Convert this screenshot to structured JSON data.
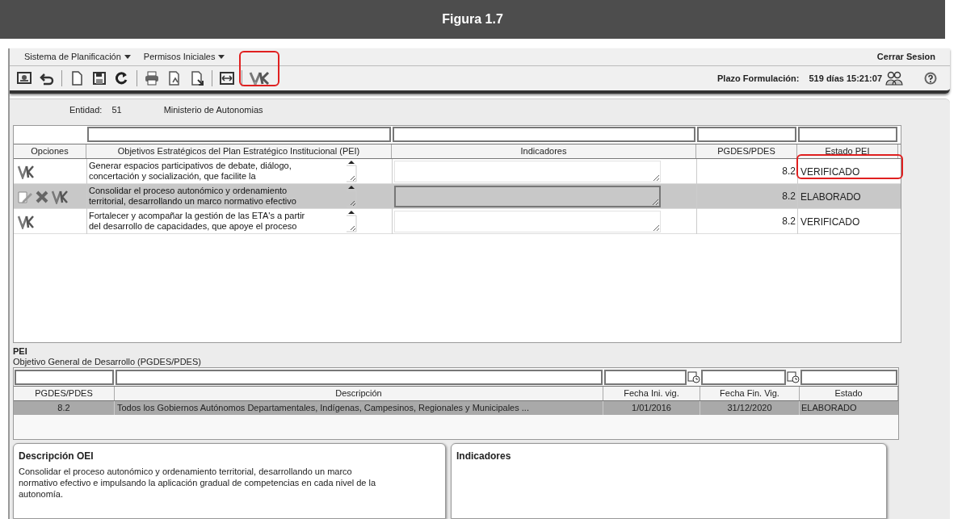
{
  "figure": {
    "title": "Figura 1.7"
  },
  "menu": [
    {
      "label": "Sistema de Planificación"
    },
    {
      "label": "Permisos Iniciales"
    }
  ],
  "logout": "Cerrar Sesion",
  "toolbar": {
    "verify_highlighted": true
  },
  "deadline": {
    "label": "Plazo Formulación:",
    "value": "519 días 15:21:07"
  },
  "entity": {
    "label": "Entidad:",
    "code": "51",
    "name": "Ministerio de Autonomias"
  },
  "objectives_table": {
    "columns": [
      "Opciones",
      "Objetivos Estratégicos del Plan Estratégico Institucional (PEI)",
      "Indicadores",
      "PGDES/PDES",
      "Estado PEI"
    ],
    "rows": [
      {
        "kind": "verify",
        "selected": false,
        "highlighted": true,
        "objective": "Generar espacios participativos de debate, diálogo, concertación y socialización, que facilite la",
        "pgdes": "8.2",
        "status": "VERIFICADO"
      },
      {
        "kind": "edit",
        "selected": true,
        "highlighted": false,
        "objective": "Consolidar el proceso autonómico y ordenamiento territorial, desarrollando un marco normativo efectivo",
        "pgdes": "8.2",
        "status": "ELABORADO"
      },
      {
        "kind": "verify",
        "selected": false,
        "highlighted": false,
        "objective": "Fortalecer y acompañar la gestión de las ETA's a partir del desarrollo de capacidades, que apoye el proceso",
        "pgdes": "8.2",
        "status": "VERIFICADO"
      }
    ]
  },
  "pei": {
    "title": "PEI",
    "subtitle": "Objetivo General de Desarrollo (PGDES/PDES)"
  },
  "development_table": {
    "columns": [
      "PGDES/PDES",
      "Descripción",
      "Fecha Ini. vig.",
      "Fecha Fin. Vig.",
      "Estado"
    ],
    "rows": [
      {
        "selected": true,
        "code": "8.2",
        "description": "Todos los Gobiernos Autónomos Departamentales, Indígenas, Campesinos, Regionales y Municipales ...",
        "start": "1/01/2016",
        "end": "31/12/2020",
        "status": "ELABORADO"
      }
    ]
  },
  "description_panel": {
    "title": "Descripción OEI",
    "text": "Consolidar el proceso autonómico y ordenamiento territorial, desarrollando un marco normativo efectivo e impulsando la aplicación gradual de competencias en cada nivel de la autonomía."
  },
  "indicators_panel": {
    "title": "Indicadores"
  }
}
